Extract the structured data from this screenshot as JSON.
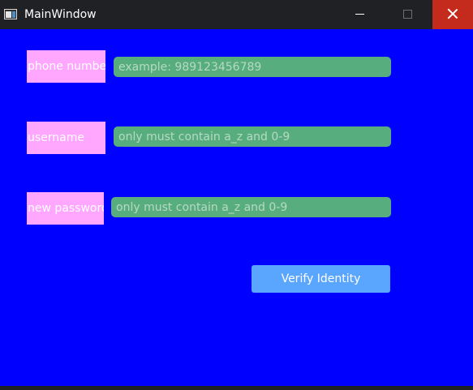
{
  "window": {
    "title": "MainWindow",
    "icon": "app-window-icon",
    "controls": {
      "minimize_icon": "minimize-icon",
      "maximize_icon": "maximize-icon",
      "close_icon": "close-icon"
    }
  },
  "form": {
    "phone": {
      "label": "phone number",
      "placeholder": "example: 989123456789",
      "value": ""
    },
    "username": {
      "label": "username",
      "placeholder": "only must contain a_z and 0-9",
      "value": ""
    },
    "password": {
      "label": "new password",
      "placeholder": "only must contain a_z and 0-9",
      "value": ""
    },
    "verify_button": "Verify Identity"
  },
  "colors": {
    "background": "#0000ff",
    "label_bg": "#ffa6ff",
    "field_bg": "#58ad7e",
    "button_bg": "#5aa6ff",
    "close_button": "#c42b1c",
    "titlebar": "#202124"
  }
}
